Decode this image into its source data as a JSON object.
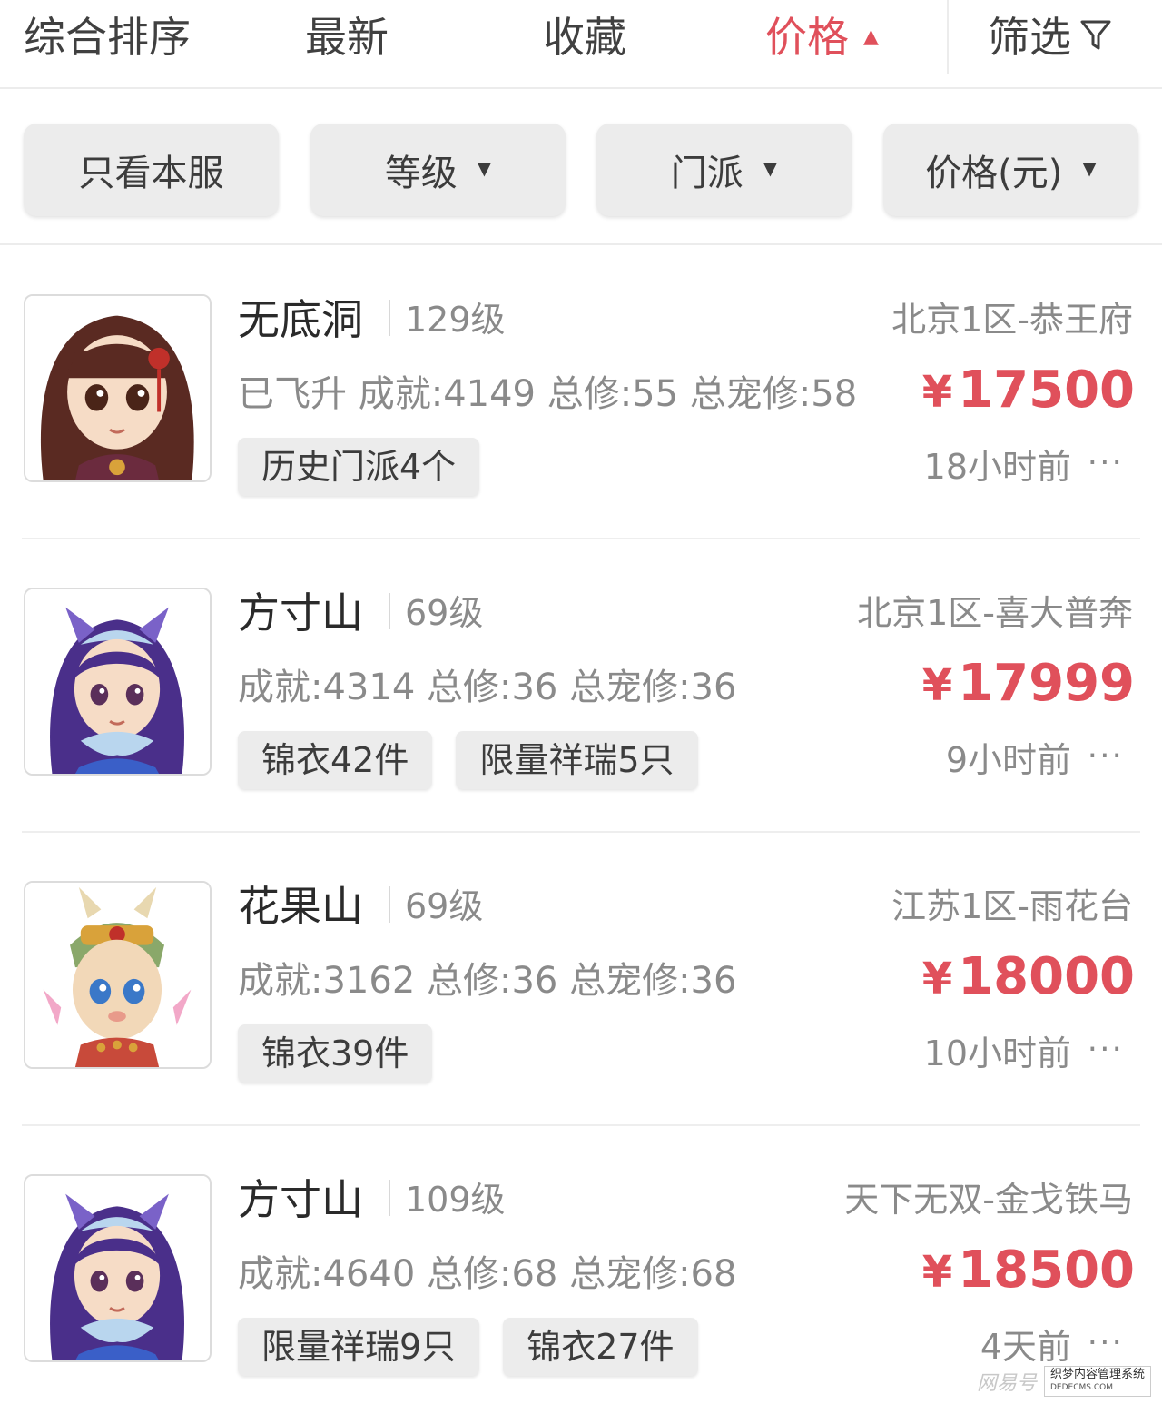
{
  "sort_tabs": [
    {
      "label": "综合排序"
    },
    {
      "label": "最新"
    },
    {
      "label": "收藏"
    },
    {
      "label": "价格"
    },
    {
      "label": "筛选"
    }
  ],
  "filters": [
    {
      "label": "只看本服"
    },
    {
      "label": "等级"
    },
    {
      "label": "门派"
    },
    {
      "label": "价格(元)"
    }
  ],
  "listings": [
    {
      "school": "无底洞",
      "level": "129级",
      "server": "北京1区-恭王府",
      "stats": "已飞升 成就:4149 总修:55 总宠修:58",
      "currency": "¥",
      "price": "17500",
      "tags": [
        "历史门派4个"
      ],
      "time": "18小时前",
      "more": "···"
    },
    {
      "school": "方寸山",
      "level": "69级",
      "server": "北京1区-喜大普奔",
      "stats": "成就:4314 总修:36 总宠修:36",
      "currency": "¥",
      "price": "17999",
      "tags": [
        "锦衣42件",
        "限量祥瑞5只"
      ],
      "time": "9小时前",
      "more": "···"
    },
    {
      "school": "花果山",
      "level": "69级",
      "server": "江苏1区-雨花台",
      "stats": "成就:3162 总修:36 总宠修:36",
      "currency": "¥",
      "price": "18000",
      "tags": [
        "锦衣39件"
      ],
      "time": "10小时前",
      "more": "···"
    },
    {
      "school": "方寸山",
      "level": "109级",
      "server": "天下无双-金戈铁马",
      "stats": "成就:4640 总修:68 总宠修:68",
      "currency": "¥",
      "price": "18500",
      "tags": [
        "限量祥瑞9只",
        "锦衣27件"
      ],
      "time": "4天前",
      "more": "···"
    }
  ],
  "watermark": {
    "left": "网易号",
    "right_top": "织梦内容管理系统",
    "right_bottom": "DEDECMS.COM"
  },
  "colors": {
    "accent": "#e0505b",
    "pill_bg": "#ececec",
    "muted_text": "#8a8a8a"
  }
}
